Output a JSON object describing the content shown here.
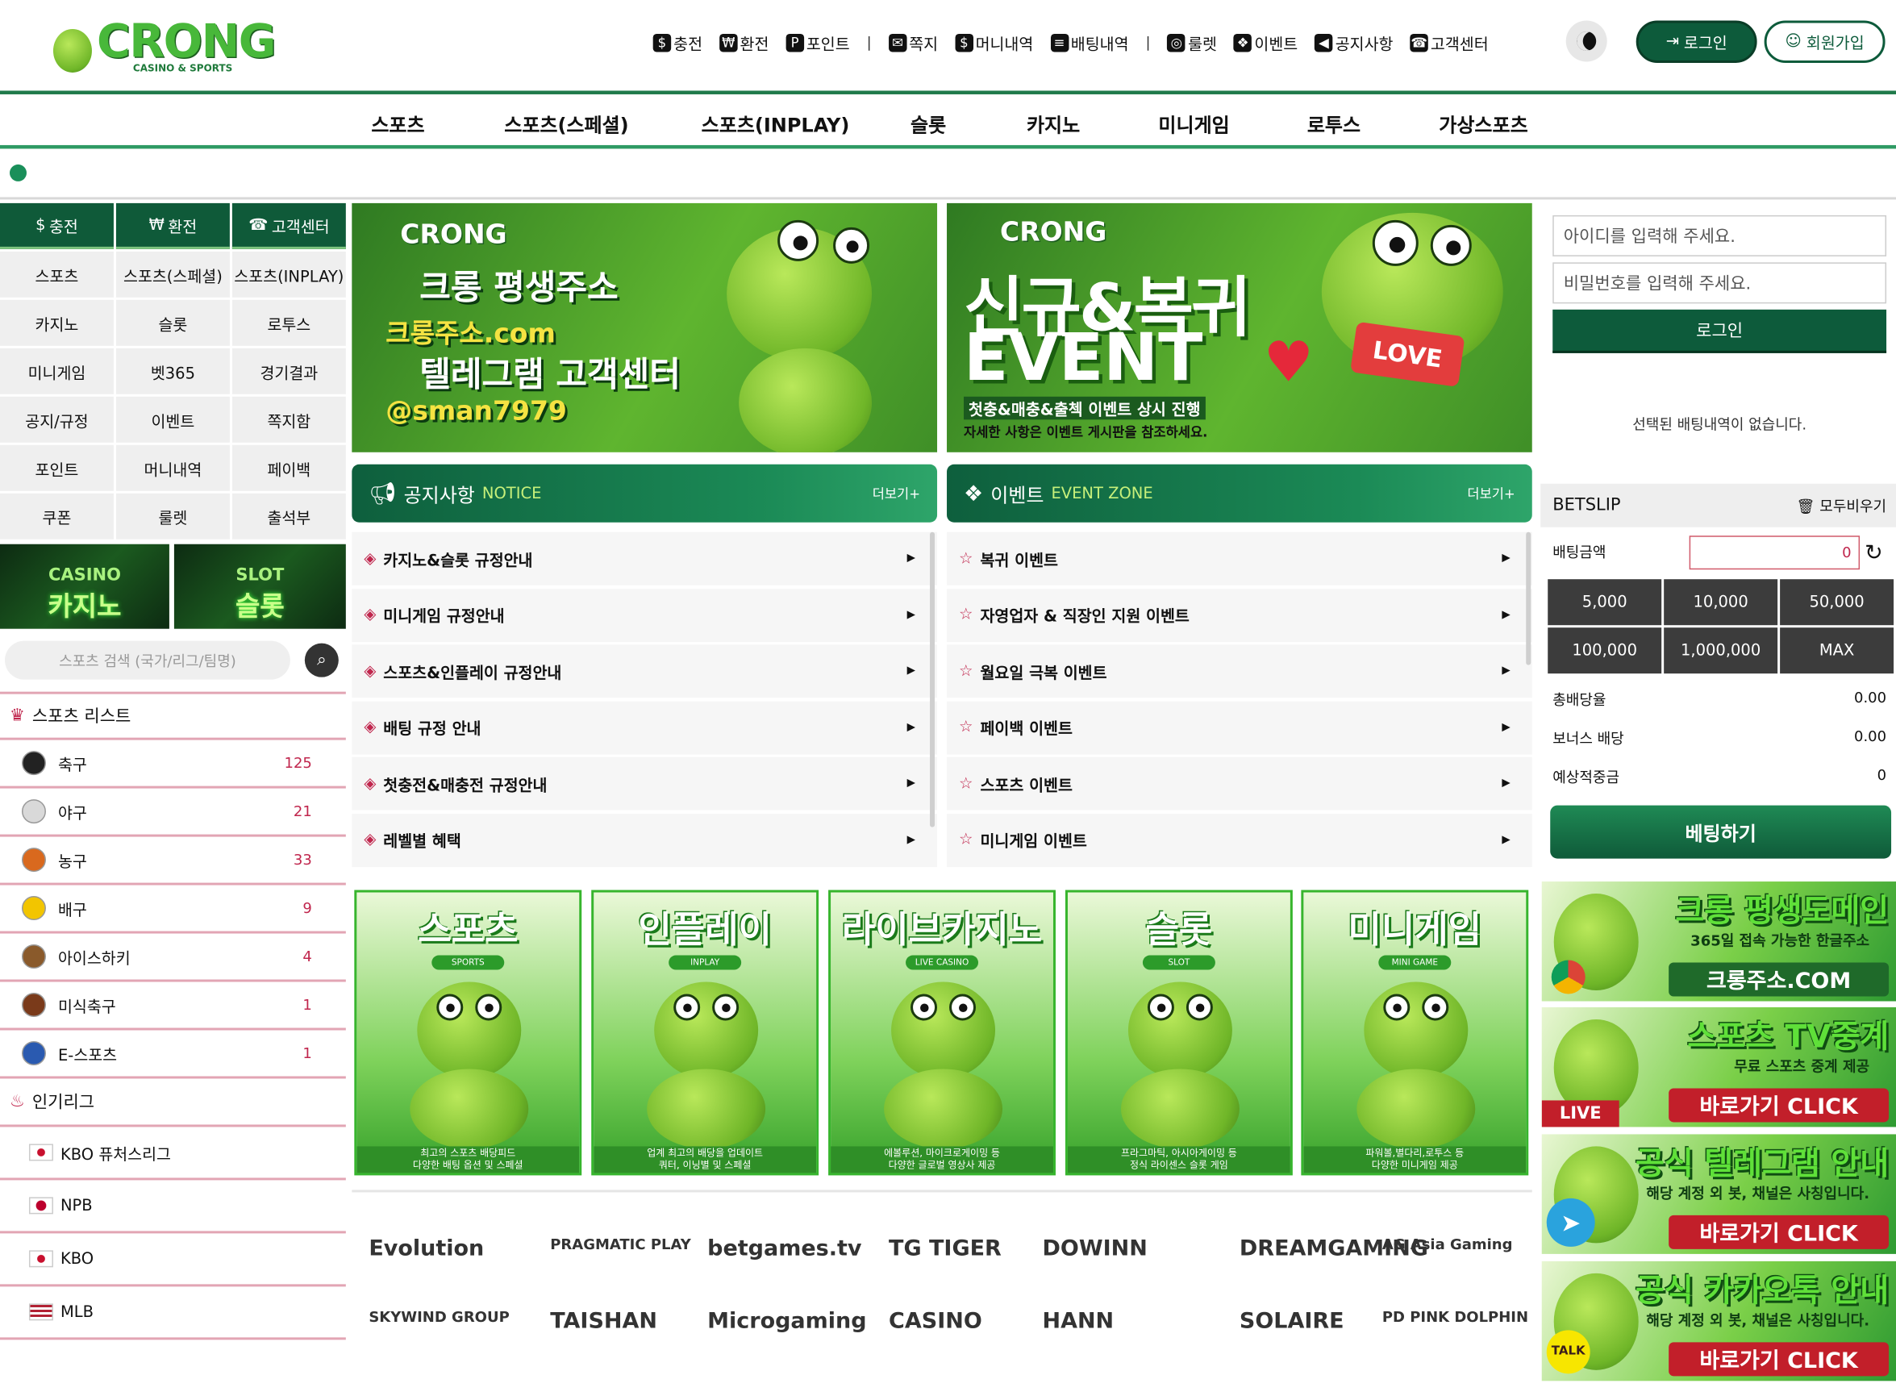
{
  "logo": {
    "name": "CRONG",
    "sub": "CASINO & SPORTS"
  },
  "topnav": [
    {
      "icon": "coin-exchange-icon",
      "glyph": "$",
      "label": "충전"
    },
    {
      "icon": "money-bag-icon",
      "glyph": "₩",
      "label": "환전"
    },
    {
      "icon": "point-icon",
      "glyph": "P",
      "label": "포인트"
    },
    {
      "icon": "mail-icon",
      "glyph": "✉",
      "label": "쪽지"
    },
    {
      "icon": "money-history-icon",
      "glyph": "$",
      "label": "머니내역"
    },
    {
      "icon": "bet-history-icon",
      "glyph": "≡",
      "label": "배팅내역"
    },
    {
      "icon": "roulette-icon",
      "glyph": "◎",
      "label": "룰렛"
    },
    {
      "icon": "gift-icon",
      "glyph": "❖",
      "label": "이벤트"
    },
    {
      "icon": "megaphone-icon",
      "glyph": "◀",
      "label": "공지사항"
    },
    {
      "icon": "headset-icon",
      "glyph": "☎",
      "label": "고객센터"
    }
  ],
  "header": {
    "login": "로그인",
    "join": "회원가입"
  },
  "mainnav": [
    "스포츠",
    "스포츠(스페셜)",
    "스포츠(INPLAY)",
    "슬롯",
    "카지노",
    "미니게임",
    "로투스",
    "가상스포츠"
  ],
  "leftgrid": {
    "heads": [
      "충전",
      "환전",
      "고객센터"
    ],
    "cells": [
      "스포츠",
      "스포츠(스페셜)",
      "스포츠(INPLAY)",
      "카지노",
      "슬롯",
      "로투스",
      "미니게임",
      "벳365",
      "경기결과",
      "공지/규정",
      "이벤트",
      "쪽지함",
      "포인트",
      "머니내역",
      "페이백",
      "쿠폰",
      "룰렛",
      "출석부"
    ]
  },
  "leftbanners": [
    {
      "t1": "CASINO",
      "t2": "카지노"
    },
    {
      "t1": "SLOT",
      "t2": "슬롯"
    }
  ],
  "search": {
    "placeholder": "스포츠 검색 (국가/리그/팀명)"
  },
  "sports": {
    "title": "스포츠 리스트",
    "items": [
      {
        "name": "축구",
        "count": "125",
        "color": "#222222"
      },
      {
        "name": "야구",
        "count": "21",
        "color": "#d9d9d9"
      },
      {
        "name": "농구",
        "count": "33",
        "color": "#d9691e"
      },
      {
        "name": "배구",
        "count": "9",
        "color": "#f2c500"
      },
      {
        "name": "아이스하키",
        "count": "4",
        "color": "#8a5a2b"
      },
      {
        "name": "미식축구",
        "count": "1",
        "color": "#7a3a1a"
      },
      {
        "name": "E-스포츠",
        "count": "1",
        "color": "#2a5ab0"
      }
    ]
  },
  "leagues": {
    "title": "인기리그",
    "items": [
      {
        "name": "KBO 퓨처스리그",
        "flag": "kr"
      },
      {
        "name": "NPB",
        "flag": "jp"
      },
      {
        "name": "KBO",
        "flag": "kr"
      },
      {
        "name": "MLB",
        "flag": "us"
      }
    ]
  },
  "banner1": {
    "logo": "CRONG",
    "l1": "크롱 평생주소",
    "l2": "크롱주소.com",
    "l3": "텔레그램 고객센터",
    "l4": "@sman7979"
  },
  "banner2": {
    "logo": "CRONG",
    "l1": "신규&복귀",
    "l2": "EVENT",
    "l3": "첫충&매충&출첵 이벤트 상시 진행",
    "l4": "자세한 사항은 이벤트 게시판을 참조하세요.",
    "love": "LOVE"
  },
  "notice": {
    "title": "공지사항",
    "sub": "NOTICE",
    "more": "더보기+",
    "items": [
      "카지노&슬롯 규정안내",
      "미니게임 규정안내",
      "스포츠&인플레이 규정안내",
      "배팅 규정 안내",
      "첫충전&매충전 규정안내",
      "레벨별 혜택"
    ]
  },
  "event": {
    "title": "이벤트",
    "sub": "EVENT ZONE",
    "more": "더보기+",
    "items": [
      "복귀 이벤트",
      "자영업자 & 직장인 지원 이벤트",
      "월요일 극복 이벤트",
      "페이백 이벤트",
      "스포츠 이벤트",
      "미니게임 이벤트"
    ]
  },
  "tiles": [
    {
      "title": "스포츠",
      "sub": "SPORTS",
      "d1": "최고의 스포츠 배당피드",
      "d2": "다양한 배팅 옵션 및 스페셜"
    },
    {
      "title": "인플레이",
      "sub": "INPLAY",
      "d1": "업계 최고의 배당을 업데이트",
      "d2": "쿼터, 이닝별 및 스페셜"
    },
    {
      "title": "라이브카지노",
      "sub": "LIVE CASINO",
      "d1": "에볼루션, 마이크로게이밍 등",
      "d2": "다양한 글로벌 영상사 제공"
    },
    {
      "title": "슬롯",
      "sub": "SLOT",
      "d1": "프라그마틱, 아시아게이밍 등",
      "d2": "정식 라이센스 슬롯 게임"
    },
    {
      "title": "미니게임",
      "sub": "MINI GAME",
      "d1": "파워볼,별다리,로투스 등",
      "d2": "다양한 미니게임 제공"
    }
  ],
  "providers": [
    "Evolution",
    "PRAGMATIC PLAY",
    "betgames.tv",
    "TG TIGER",
    "DOWINN",
    "DREAMGAMING",
    "AG Asia Gaming",
    "SKYWIND GROUP",
    "TAISHAN",
    "Microgaming",
    "CASINO",
    "HANN",
    "SOLAIRE",
    "PD PINK DOLPHIN"
  ],
  "right": {
    "id_placeholder": "아이디를 입력해 주세요.",
    "pw_placeholder": "비밀번호를 입력해 주세요.",
    "login": "로그인",
    "nobet": "선택된 배팅내역이 없습니다.",
    "betslip": "BETSLIP",
    "clear": "모두비우기",
    "amount_label": "배팅금액",
    "amount": "0",
    "chips": [
      "5,000",
      "10,000",
      "50,000",
      "100,000",
      "1,000,000",
      "MAX"
    ],
    "odds": [
      {
        "label": "총배당율",
        "value": "0.00"
      },
      {
        "label": "보너스 배당",
        "value": "0.00"
      },
      {
        "label": "예상적중금",
        "value": "0"
      }
    ],
    "bet_button": "베팅하기"
  },
  "sidebanners": [
    {
      "t1": "크롱 평생도메인",
      "t2": "365일 접속 가능한 한글주소",
      "t3": "크롱주소.COM",
      "badge": ""
    },
    {
      "t1": "스포츠 TV중계",
      "t2": "무료 스포츠 중계 제공",
      "t3": "바로가기 CLICK",
      "badge": "LIVE"
    },
    {
      "t1": "공식 텔레그램 안내",
      "t2": "해당 계정 외 봇, 채널은 사칭입니다.",
      "t3": "바로가기 CLICK",
      "badge": ""
    },
    {
      "t1": "공식 카카오톡 안내",
      "t2": "해당 계정 외 봇, 채널은 사칭입니다.",
      "t3": "바로가기 CLICK",
      "badge": "TALK"
    }
  ],
  "colors": {
    "brand_dark": "#0d5b3b",
    "brand_green": "#48b83a",
    "accent_red": "#c0264d"
  }
}
